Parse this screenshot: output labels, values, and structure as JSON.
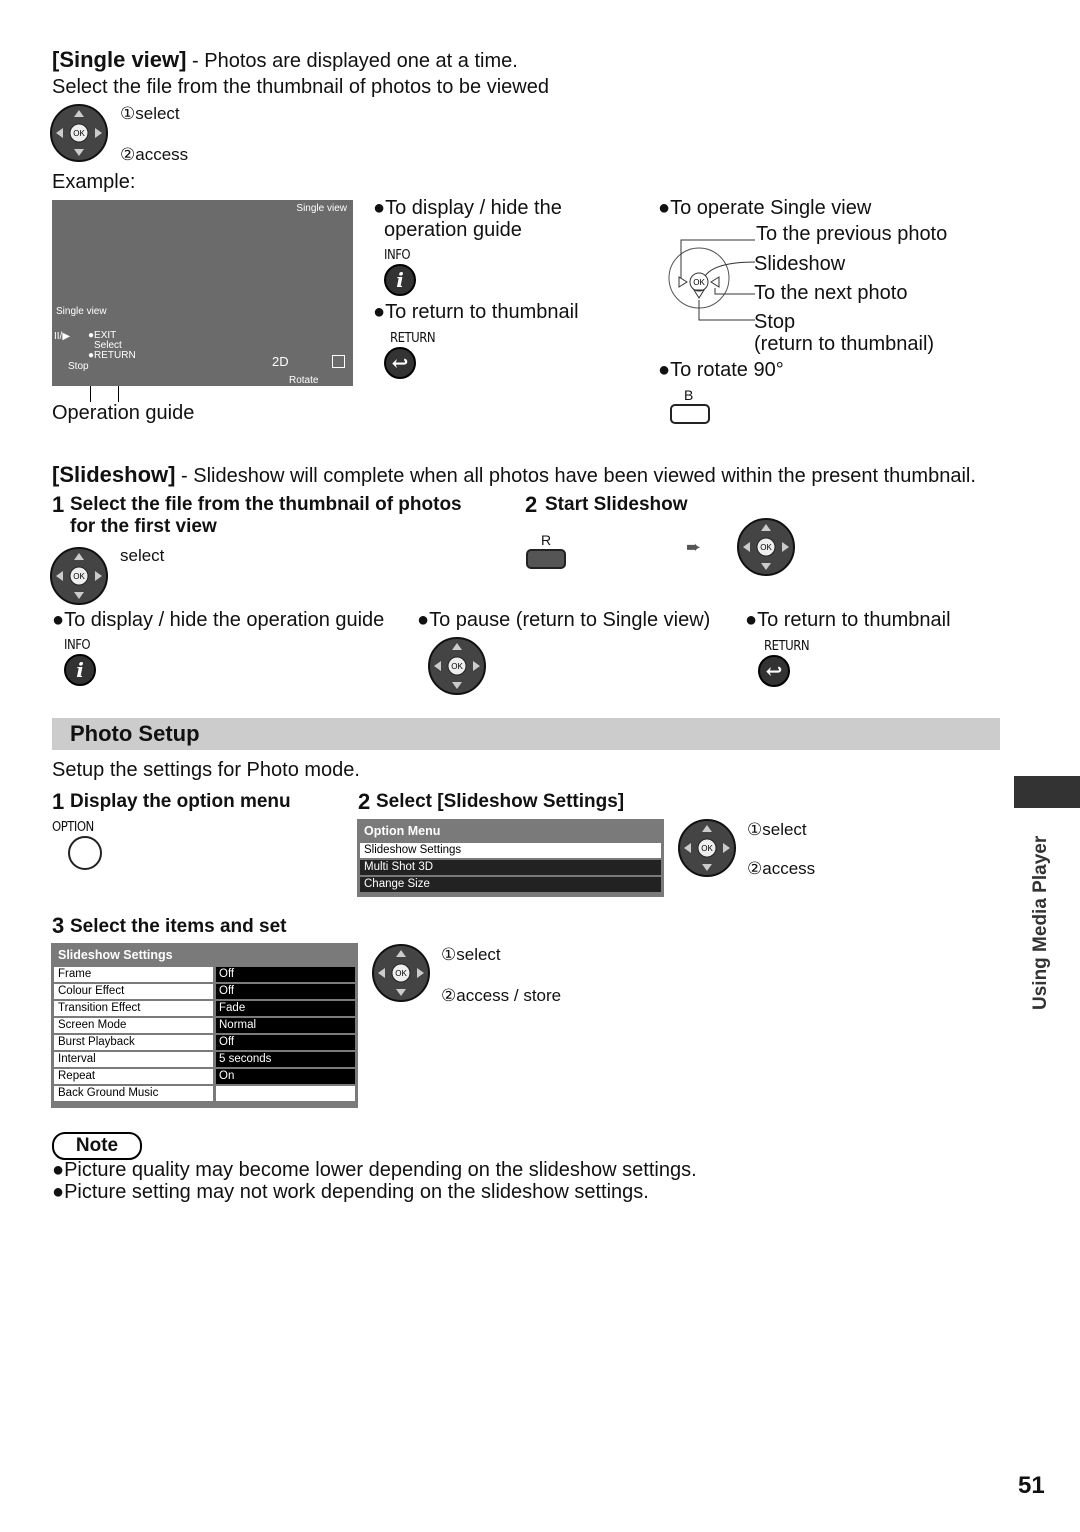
{
  "single_view": {
    "title": "[Single view]",
    "desc": " - Photos are displayed one at a time.",
    "instruction": "Select the file from the thumbnail of photos to be viewed",
    "select": "①select",
    "access": "②access",
    "example": "Example:",
    "screen": {
      "badge": "Single view",
      "guide_title": "Single view",
      "exit": "●EXIT",
      "select": "Select",
      "return": "●RETURN",
      "stop": "Stop",
      "mode": "2D",
      "rotate": "Rotate",
      "play": "II/▶"
    },
    "operation_guide": "Operation guide",
    "display_hide": "●To display / hide the",
    "display_hide2": "operation guide",
    "info_label": "INFO",
    "return_thumb": "●To return to thumbnail",
    "return_label": "RETURN",
    "operate": "●To operate Single view",
    "prev": "To the previous photo",
    "slideshow": "Slideshow",
    "next": "To the next photo",
    "stop": "Stop",
    "stop2": "(return to thumbnail)",
    "rotate": "●To rotate 90°",
    "b_label": "B"
  },
  "slideshow": {
    "title": "[Slideshow]",
    "desc": " - Slideshow will complete when all photos have been viewed within the present thumbnail.",
    "step1_num": "1",
    "step1": "Select the file from the thumbnail of photos",
    "step1b": "for the first view",
    "select": "select",
    "step2_num": "2",
    "step2": "Start Slideshow",
    "r_label": "R",
    "display_hide": "●To display / hide the operation guide",
    "info_label": "INFO",
    "pause": "●To pause (return to Single view)",
    "return_thumb": "●To return to thumbnail",
    "return_label": "RETURN"
  },
  "photo_setup": {
    "title": "Photo Setup",
    "desc": "Setup the settings for Photo mode.",
    "step1_num": "1",
    "step1": "Display the option menu",
    "option_label": "OPTION",
    "step2_num": "2",
    "step2": "Select [Slideshow Settings]",
    "option_menu": {
      "title": "Option Menu",
      "items": [
        "Slideshow Settings",
        "Multi Shot 3D",
        "Change Size"
      ]
    },
    "select": "①select",
    "access": "②access",
    "step3_num": "3",
    "step3": "Select the items and set",
    "settings": {
      "title": "Slideshow Settings",
      "rows": [
        [
          "Frame",
          "Off"
        ],
        [
          "Colour Effect",
          "Off"
        ],
        [
          "Transition Effect",
          "Fade"
        ],
        [
          "Screen Mode",
          "Normal"
        ],
        [
          "Burst Playback",
          "Off"
        ],
        [
          "Interval",
          "5 seconds"
        ],
        [
          "Repeat",
          "On"
        ],
        [
          "Back Ground Music",
          ""
        ]
      ]
    },
    "select3": "①select",
    "access3": "②access / store"
  },
  "note": {
    "label": "Note",
    "items": [
      "●Picture quality may become lower depending on the slideshow settings.",
      "●Picture setting may not work depending on the slideshow settings."
    ]
  },
  "side_tab": "Using Media Player",
  "page_number": "51"
}
